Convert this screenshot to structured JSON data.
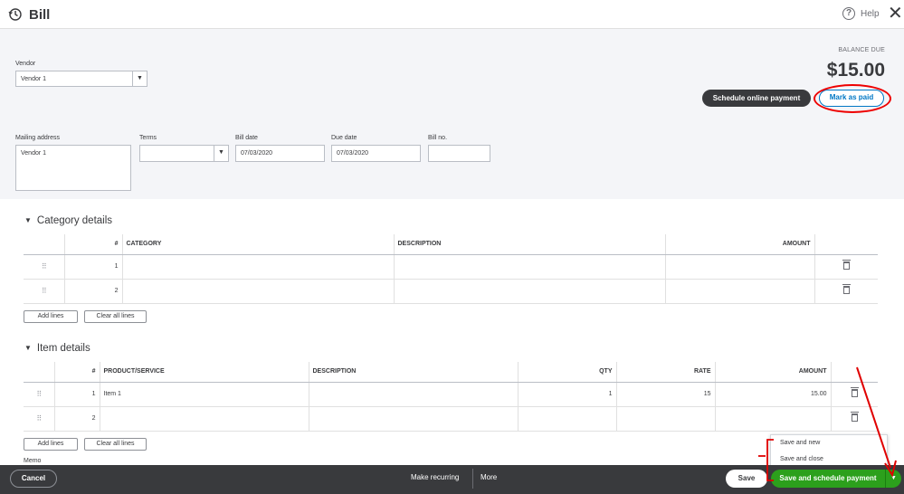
{
  "header": {
    "title": "Bill",
    "help_label": "Help"
  },
  "vendor": {
    "label": "Vendor",
    "value": "Vendor 1"
  },
  "balance": {
    "label": "BALANCE DUE",
    "value": "$15.00"
  },
  "actions": {
    "schedule_payment": "Schedule online payment",
    "mark_paid": "Mark as paid"
  },
  "fields": {
    "mailing_address": {
      "label": "Mailing address",
      "value": "Vendor 1"
    },
    "terms": {
      "label": "Terms",
      "value": ""
    },
    "bill_date": {
      "label": "Bill date",
      "value": "07/03/2020"
    },
    "due_date": {
      "label": "Due date",
      "value": "07/03/2020"
    },
    "bill_no": {
      "label": "Bill no.",
      "value": ""
    }
  },
  "category": {
    "title": "Category details",
    "headers": {
      "num": "#",
      "category": "CATEGORY",
      "description": "DESCRIPTION",
      "amount": "AMOUNT"
    },
    "rows": [
      {
        "num": "1"
      },
      {
        "num": "2"
      }
    ],
    "add_lines": "Add lines",
    "clear_lines": "Clear all lines"
  },
  "items": {
    "title": "Item details",
    "headers": {
      "num": "#",
      "product": "PRODUCT/SERVICE",
      "description": "DESCRIPTION",
      "qty": "QTY",
      "rate": "RATE",
      "amount": "AMOUNT"
    },
    "rows": [
      {
        "num": "1",
        "product": "Item 1",
        "description": "",
        "qty": "1",
        "rate": "15",
        "amount": "15.00"
      },
      {
        "num": "2",
        "product": "",
        "description": "",
        "qty": "",
        "rate": "",
        "amount": ""
      }
    ],
    "add_lines": "Add lines",
    "clear_lines": "Clear all lines"
  },
  "memo": {
    "label": "Memo"
  },
  "footer": {
    "cancel": "Cancel",
    "make_recurring": "Make recurring",
    "more": "More",
    "save": "Save",
    "save_schedule": "Save and schedule payment",
    "menu": [
      "Save and new",
      "Save and close"
    ]
  },
  "colors": {
    "accent_blue": "#0077c5",
    "green": "#2ca01c",
    "dark": "#393a3d",
    "annotation_red": "#e00000"
  }
}
